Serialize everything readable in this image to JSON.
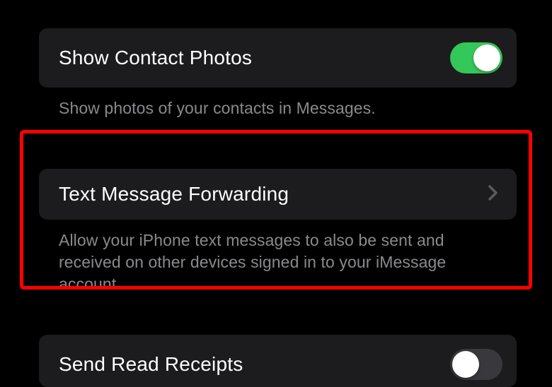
{
  "settings": {
    "contact_photos": {
      "label": "Show Contact Photos",
      "description": "Show photos of your contacts in Messages.",
      "enabled": true
    },
    "text_forwarding": {
      "label": "Text Message Forwarding",
      "description": "Allow your iPhone text messages to also be sent and received on other devices signed in to your iMessage account."
    },
    "read_receipts": {
      "label": "Send Read Receipts",
      "enabled": false
    }
  },
  "highlight": {
    "target": "text_forwarding",
    "color": "#ff0000"
  }
}
